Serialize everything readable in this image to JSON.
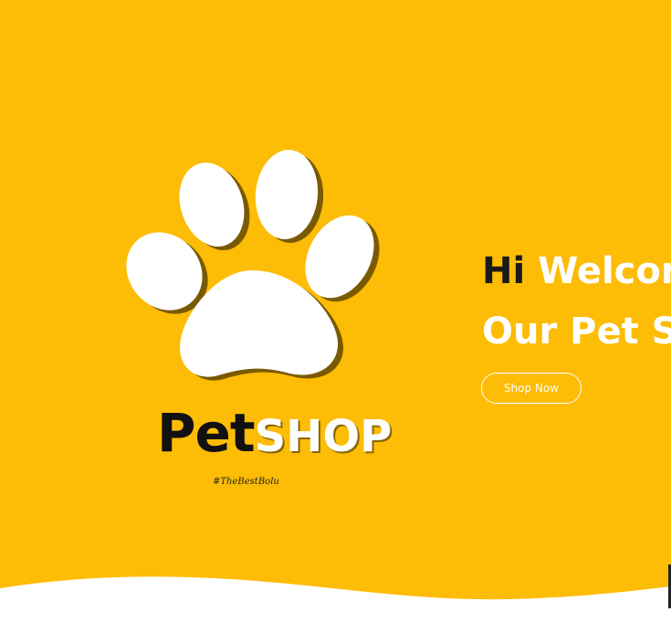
{
  "hero": {
    "background_color": "#FDBC05",
    "logo": {
      "brand_part1": "Pet",
      "brand_part2": "SHOP",
      "tagline": "#TheBestBolu"
    },
    "headline": {
      "word_dark": "Hi",
      "line1_rest": "Welcome to",
      "line2": "Our Pet Shop"
    },
    "cta_label": "Shop Now"
  }
}
